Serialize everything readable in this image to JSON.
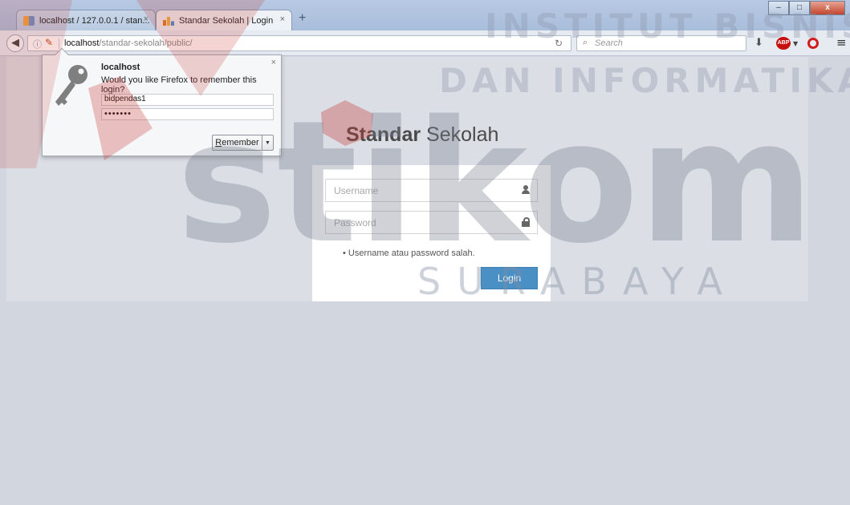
{
  "browser": {
    "tabs": [
      {
        "title": "localhost / 127.0.0.1 / stan...",
        "close": "×"
      },
      {
        "title": "Standar Sekolah | Login",
        "close": "×"
      }
    ],
    "new_tab": "+",
    "window_controls": {
      "minimize": "–",
      "maximize": "□",
      "close": "x"
    },
    "url": {
      "host": "localhost",
      "path": "/standar-sekolah/public/"
    },
    "search_placeholder": "Search",
    "adblock_label": "ABP"
  },
  "password_prompt": {
    "host": "localhost",
    "question": "Would you like Firefox to remember this login?",
    "username": "bidpendas1",
    "password_mask": "•••••••",
    "remember_accesskey": "R",
    "remember_rest": "emember",
    "dropdown_arrow": "▼",
    "close": "×"
  },
  "login_page": {
    "brand_bold": "Standar",
    "brand_regular": " Sekolah",
    "username_placeholder": "Username",
    "password_placeholder": "Password",
    "error_message": "Username atau password salah.",
    "login_button": "Login",
    "button_color": "#4a90c4"
  },
  "watermark": {
    "line1": "INSTITUT BISNIS",
    "line2": "DAN INFORMATIKA",
    "logo_text": "stikom",
    "line3": "SURABAYA"
  }
}
